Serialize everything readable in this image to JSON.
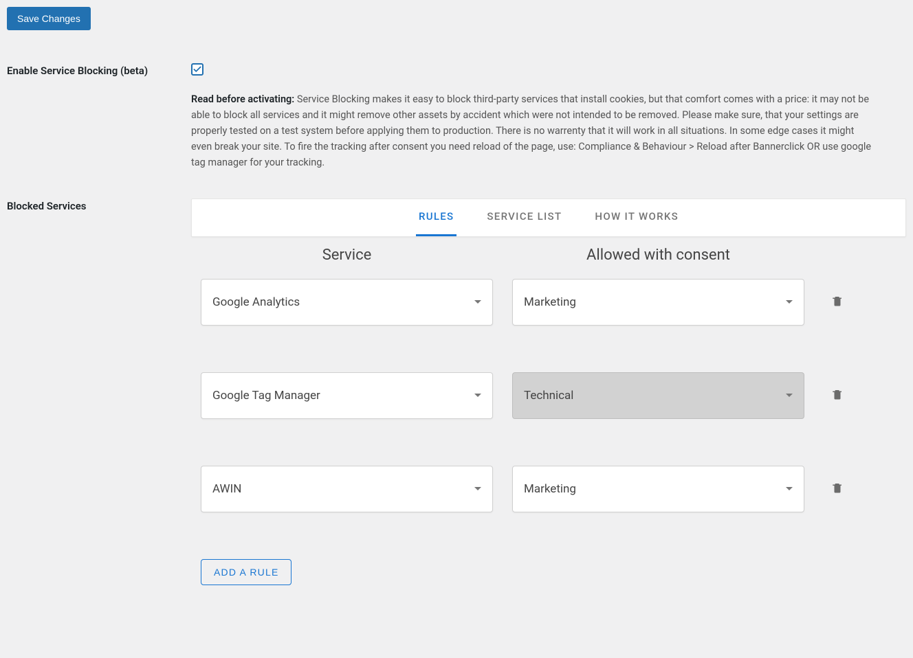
{
  "save_button": "Save Changes",
  "enable_block": {
    "label": "Enable Service Blocking (beta)",
    "checked": true,
    "desc_bold": "Read before activating:",
    "desc_rest": " Service Blocking makes it easy to block third-party services that install cookies, but that comfort comes with a price: it may not be able to block all services and it might remove other assets by accident which were not intended to be removed. Please make sure, that your settings are properly tested on a test system before applying them to production. There is no warrenty that it will work in all situations. In some edge cases it might even break your site. To fire the tracking after consent you need reload of the page, use: Compliance & Behaviour > Reload after Bannerclick OR use google tag manager for your tracking."
  },
  "blocked": {
    "label": "Blocked Services",
    "tabs": {
      "rules": "RULES",
      "service_list": "SERVICE LIST",
      "how": "HOW IT WORKS"
    },
    "columns": {
      "service": "Service",
      "consent": "Allowed with consent"
    },
    "rules": [
      {
        "service": "Google Analytics",
        "consent": "Marketing",
        "consent_grey": false
      },
      {
        "service": "Google Tag Manager",
        "consent": "Technical",
        "consent_grey": true
      },
      {
        "service": "AWIN",
        "consent": "Marketing",
        "consent_grey": false
      }
    ],
    "add_rule": "ADD A RULE"
  }
}
